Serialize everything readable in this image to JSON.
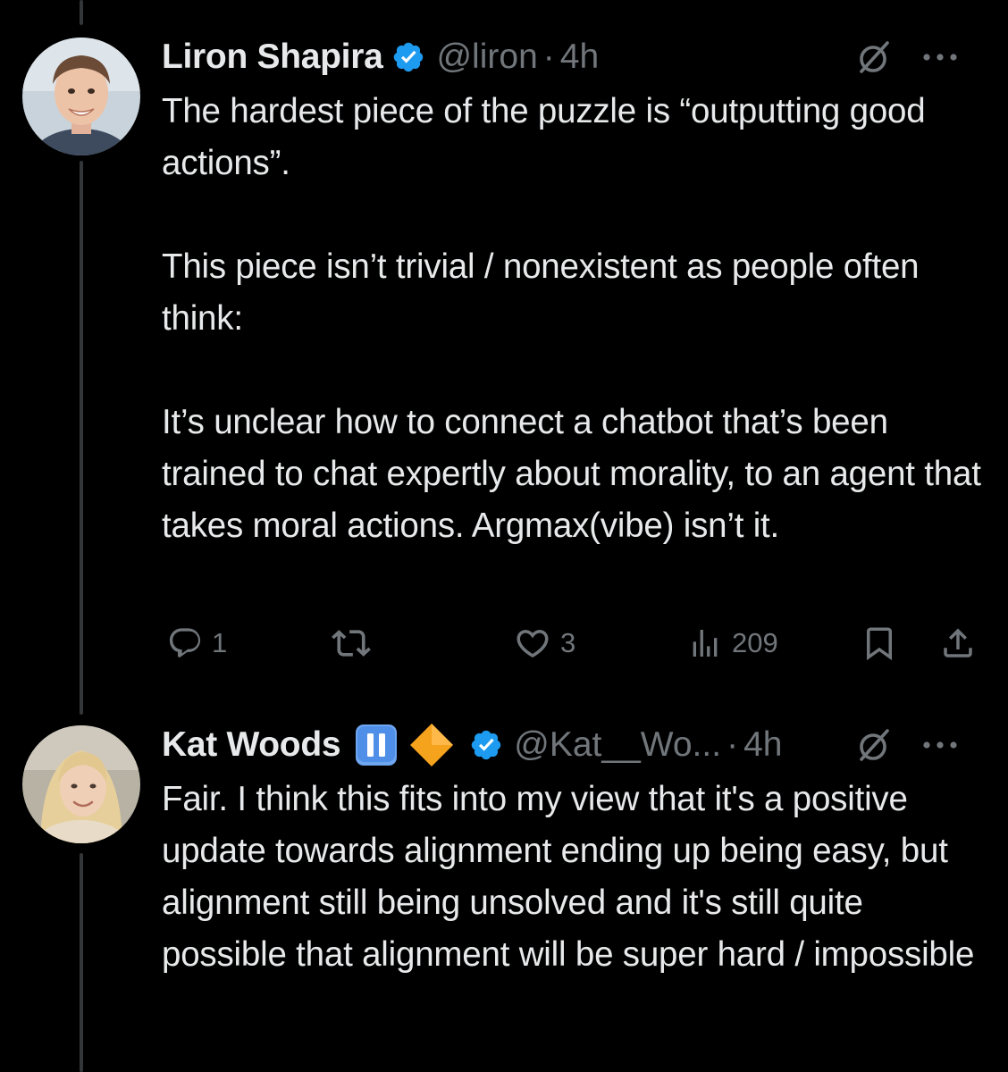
{
  "tweets": [
    {
      "display_name": "Liron Shapira",
      "handle": "@liron",
      "separator": "·",
      "time": "4h",
      "verified": true,
      "text": [
        "The hardest piece of the puzzle is “outputting good actions”.",
        "This piece isn’t trivial / nonexistent as people often think:",
        "It’s unclear how to connect a chatbot that’s been trained to chat expertly about morality, to an agent that takes moral actions. Argmax(vibe) isn’t it."
      ],
      "actions": {
        "replies": "1",
        "retweets": "",
        "likes": "3",
        "views": "209"
      }
    },
    {
      "display_name": "Kat Woods",
      "handle": "@Kat__Wo...",
      "separator": "·",
      "time": "4h",
      "verified": true,
      "badges": [
        "pause-button-emoji",
        "orange-diamond-emoji"
      ],
      "text": [
        "Fair. I think this fits into my view that it's a positive update towards alignment ending up being easy, but alignment still being unsolved and it's still quite possible that alignment will be super hard / impossible"
      ]
    }
  ],
  "icons": {
    "verified": "verified-badge-icon",
    "grok": "grok-icon",
    "more": "more-icon",
    "reply": "reply-icon",
    "retweet": "retweet-icon",
    "like": "heart-icon",
    "views": "views-icon",
    "bookmark": "bookmark-icon",
    "share": "share-icon"
  },
  "colors": {
    "background": "#000000",
    "text_primary": "#e7e9ea",
    "text_secondary": "#71767b",
    "verified_blue": "#1d9bf0",
    "thread_line": "#333639"
  }
}
